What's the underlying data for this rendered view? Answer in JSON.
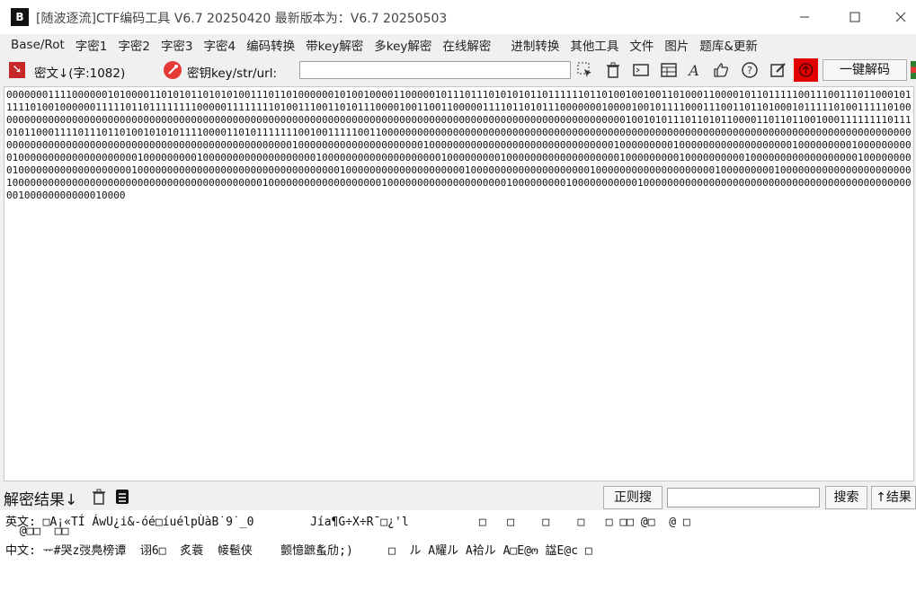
{
  "window": {
    "title": "[随波逐流]CTF编码工具 V6.7 20250420     最新版本为：V6.7  20250503"
  },
  "menu": [
    "Base/Rot",
    "字密1",
    "字密2",
    "字密3",
    "字密4",
    "编码转换",
    "带key解密",
    "多key解密",
    "在线解密",
    "进制转换",
    "其他工具",
    "文件",
    "图片",
    "题库&更新"
  ],
  "toolbar": {
    "cipher_label": "密文↓(字:1082)",
    "key_label": "密钥key/str/url:",
    "key_value": "",
    "decode_button": "一键解码"
  },
  "ciphertext": "000000011110000001010000110101011010101001110110100000010100100001100000101110111010101011011111101101001001001101000110000101101111100111001110110001011111010010000001111101101111111100000111111110100111001101011100001001100110000011110110101110000000100001001011110001110011011010001011111010011111010000000000000000000000000000000000000000000000000000000000000000000000000000000000000000000000000000000000100101011101101011000011011011001000111111110111010110001111011101101001010101111000011010111111100100111110011000000000000000000000000000000000000000000000000000000000000000000000000000000000000000000000000000000000000000000000000000000000000000001000000000000000000000100000000000000000000000000000001000000000100000000000000000001000000000100000000001000000000000000000001000000000100000000000000000001000000000000000000001000000000100000000000000000001000000000100000000001000000000000000000100000000010000000000000000000100000000000000000000000000000000001000000000000000000001000000000000000000001000000000000000000001000000000100000000000000000000001000000000000000000000000000000000000000000100000000000000000001000000000000000000001000000000100000000000100000000000000000000000000000000000000000000000100000000000010000",
  "result": {
    "label": "解密结果↓",
    "regex_button": "正则搜",
    "search_value": "",
    "search_button": "搜索",
    "result_button": "↑结果",
    "line_en": "英文: □A¡«TÍ ÁwU¿i&-óé□íuélpÙàB˙9˙_0        Jía¶G÷X÷R¯□¿'l          □   □    □    □   □ □□ @□  @ □",
    "line_en2": "  @□□  □□",
    "line_cn": "中文: ᅲ#哭z弢鳧榜谭  诩6□  炙蓑  帹髱侠    颤憶蹠蚃劤;)     □  ル A耀ル A袷ル A□E@ო 諡E@c □"
  },
  "colors": {
    "accent_red": "#e53935",
    "title_bg": "#ffffff",
    "chrome_bg": "#f0f0f0"
  }
}
